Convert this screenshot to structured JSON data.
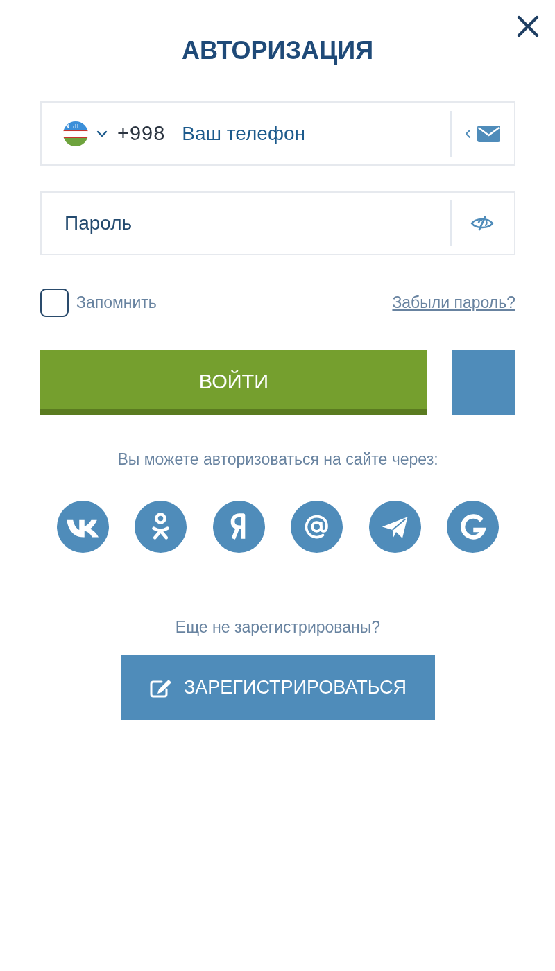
{
  "title": "АВТОРИЗАЦИЯ",
  "phone_field": {
    "country_code": "+998",
    "placeholder": "Ваш телефон"
  },
  "password_field": {
    "placeholder": "Пароль"
  },
  "remember": {
    "label": "Запомнить",
    "checked": false
  },
  "forgot_password": "Забыли пароль?",
  "login_button": "ВОЙТИ",
  "social_caption": "Вы можете авторизоваться на сайте через:",
  "register": {
    "prompt": "Еще не зарегистрированы?",
    "button": "ЗАРЕГИСТРИРОВАТЬСЯ"
  }
}
